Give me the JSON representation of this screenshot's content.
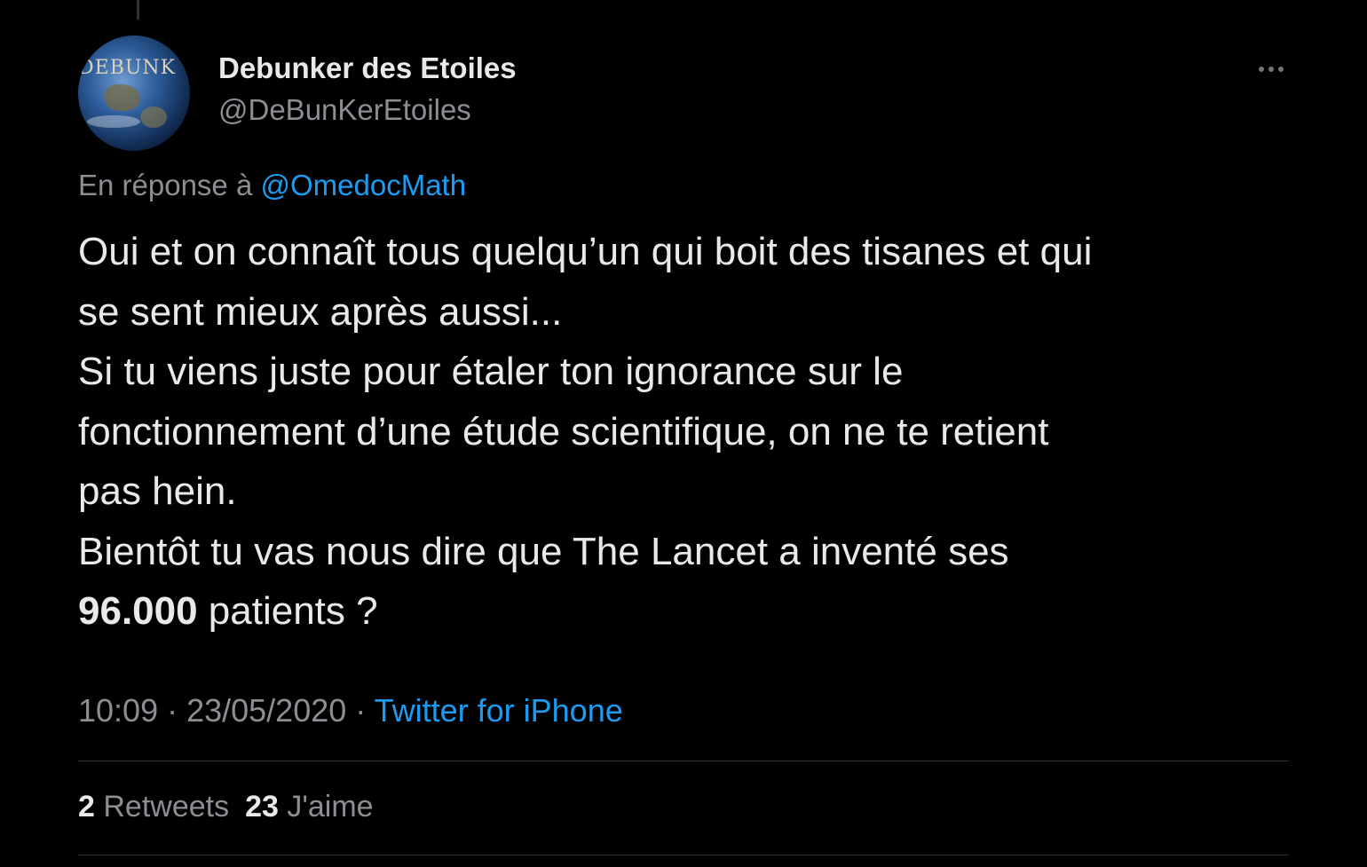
{
  "tweet": {
    "author": {
      "display_name": "Debunker des Etoiles",
      "handle": "@DeBunKerEtoiles",
      "avatar_text": "DEBUNK"
    },
    "reply_prefix": "En réponse à ",
    "reply_mention": "@OmedocMath",
    "text_lines": [
      "Oui et on connaît tous quelqu’un qui boit des tisanes et qui",
      "se sent mieux après aussi...",
      "Si tu viens juste pour étaler ton ignorance sur le",
      "fonctionnement d’une étude scientifique, on ne te retient",
      "pas hein.",
      "Bientôt tu vas nous dire que The Lancet a inventé ses"
    ],
    "last_line_bold": "96.000",
    "last_line_rest": " patients ?",
    "time": "10:09",
    "separator": " · ",
    "date": "23/05/2020",
    "source": "Twitter for iPhone",
    "retweets_count": "2",
    "retweets_label": " Retweets",
    "likes_count": "23",
    "likes_label": " J'aime"
  },
  "colors": {
    "background": "#000000",
    "text": "#e7e9ea",
    "secondary": "#8b8f94",
    "link": "#1d9bf0",
    "divider": "#2f3336"
  },
  "icons": {
    "more": "more-horizontal-icon"
  }
}
